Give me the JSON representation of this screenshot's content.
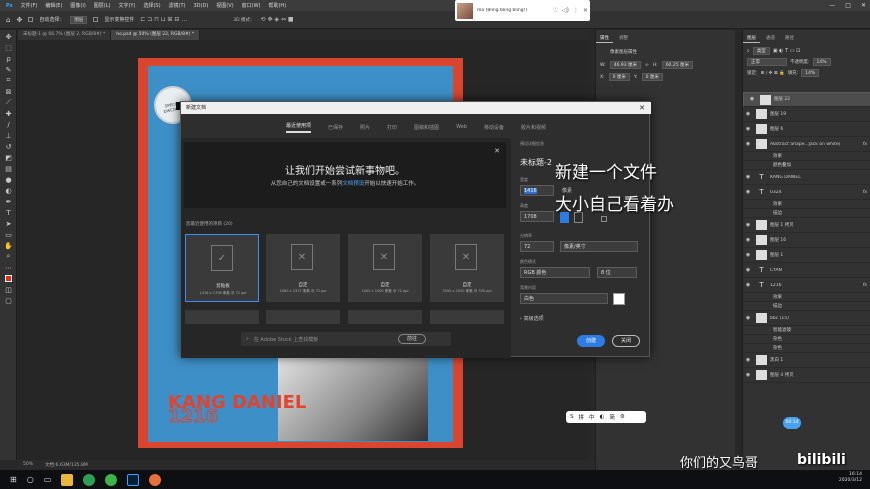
{
  "menu": {
    "items": [
      "文件(F)",
      "编辑(E)",
      "图像(I)",
      "图层(L)",
      "文字(Y)",
      "选择(S)",
      "滤镜(T)",
      "3D(D)",
      "视图(V)",
      "窗口(W)",
      "帮助(H)"
    ],
    "window_controls": [
      "—",
      "□",
      "✕"
    ]
  },
  "options_bar": {
    "auto_select_label": "自动选择：",
    "auto_select_value": "图层",
    "show_transform_label": "显示变换控件"
  },
  "tabs": [
    {
      "label": "未标题-1 @ 66.7% (图层 2, RGB/8#) *"
    },
    {
      "label": "ho.psd @ 50% (图层 22, RGB/8#) *"
    }
  ],
  "status": {
    "zoom": "50%",
    "doc": "文档:6.63M/135.8M"
  },
  "properties_panel": {
    "tabs": [
      "属性",
      "调整"
    ],
    "subtitle": "像素图层属性",
    "w_label": "W:",
    "w_value": "46.93 厘米",
    "h_label": "H:",
    "h_value": "60.25 厘米",
    "x_label": "X:",
    "x_value": "0 厘米",
    "y_label": "Y:",
    "y_value": "0 厘米"
  },
  "layers_panel": {
    "tabs": [
      "图层",
      "通道",
      "路径"
    ],
    "kind_label": "类型",
    "blend_mode": "正常",
    "opacity_label": "不透明度:",
    "opacity_value": "14%",
    "lock_label": "锁定:",
    "fill_label": "填充:",
    "fill_value": "14%",
    "layers": [
      {
        "name": "图层 22",
        "kind": "pixel",
        "selected": true
      },
      {
        "name": "图层 19",
        "kind": "pixel"
      },
      {
        "name": "图层 6",
        "kind": "pixel"
      },
      {
        "name": "Abstract Shape...Jack on white]",
        "kind": "pixel",
        "fx": "fx"
      },
      {
        "name": "效果",
        "kind": "sub"
      },
      {
        "name": "颜色叠加",
        "kind": "sub"
      },
      {
        "name": "KANG DANIEL",
        "kind": "text"
      },
      {
        "name": "0324",
        "kind": "text",
        "fx": "fx"
      },
      {
        "name": "效果",
        "kind": "sub"
      },
      {
        "name": "描边",
        "kind": "sub"
      },
      {
        "name": "图层 1 拷贝",
        "kind": "pixel"
      },
      {
        "name": "图层 16",
        "kind": "pixel"
      },
      {
        "name": "图层 1",
        "kind": "pixel"
      },
      {
        "name": "CYAN",
        "kind": "text"
      },
      {
        "name": "1216",
        "kind": "text",
        "fx": "fx"
      },
      {
        "name": "效果",
        "kind": "sub"
      },
      {
        "name": "描边",
        "kind": "sub"
      },
      {
        "name": "bbc (15)",
        "kind": "pixel"
      },
      {
        "name": "智能滤镜",
        "kind": "sub"
      },
      {
        "name": "杂色",
        "kind": "sub"
      },
      {
        "name": "杂色",
        "kind": "sub"
      },
      {
        "name": "黑白 1",
        "kind": "adjust"
      },
      {
        "name": "图层 4 拷贝",
        "kind": "pixel"
      }
    ]
  },
  "music": {
    "title": "ma (Bling bling bling!)",
    "controls": [
      "♡",
      "◁)",
      "⋮",
      "✕"
    ]
  },
  "dialog": {
    "title": "新建文档",
    "nav": [
      "最近使用项",
      "已保存",
      "照片",
      "打印",
      "图稿和插图",
      "Web",
      "移动设备",
      "胶片和视频"
    ],
    "welcome_title": "让我们开始尝试新事物吧。",
    "welcome_sub_pre": "从您自己的文档设置或一系列",
    "welcome_sub_link": "文档预设",
    "welcome_sub_post": "开始以快速开始工作。",
    "recent_label": "您最近使用的项目 (20)",
    "presets": [
      {
        "name": "剪贴板",
        "size": "1416 x 1708 像素 @ 72 ppi"
      },
      {
        "name": "自定",
        "size": "1080 x 2337 像素 @ 72 ppi"
      },
      {
        "name": "自定",
        "size": "1000 x 1000 像素 @ 72 ppi"
      },
      {
        "name": "自定",
        "size": "3000 x 2000 像素 @ 300 ppi"
      }
    ],
    "stock_placeholder": "在 Adobe Stock 上查找模板",
    "stock_go": "前往",
    "right": {
      "section": "预设详细信息",
      "doc_name": "未标题-2",
      "width_label": "宽度",
      "width_value": "1416",
      "width_unit": "像素",
      "height_label": "高度",
      "height_value": "1708",
      "orientation_label": "方向",
      "resolution_label": "分辨率",
      "resolution_value": "72",
      "resolution_unit": "像素/英寸",
      "color_mode_label": "颜色模式",
      "color_mode_value": "RGB 颜色",
      "bit_depth": "8 位",
      "bg_label": "背景内容",
      "bg_value": "白色",
      "advanced": "高级选项",
      "create": "创建",
      "close": "关闭"
    }
  },
  "captions": {
    "line1": "新建一个文件",
    "line2": "大小自己看着办"
  },
  "ime": {
    "items": [
      "拼",
      "中",
      "简"
    ]
  },
  "watermark": "你们的又鸟哥",
  "bilibili": "bilibili",
  "timer": "00:14",
  "clock": {
    "time": "16:14",
    "date": "2020/3/12"
  },
  "poster": {
    "stamp_text": "SPECIAL DISCOUNT",
    "big_text": "KANG DANIEL",
    "big_num": "1216"
  }
}
